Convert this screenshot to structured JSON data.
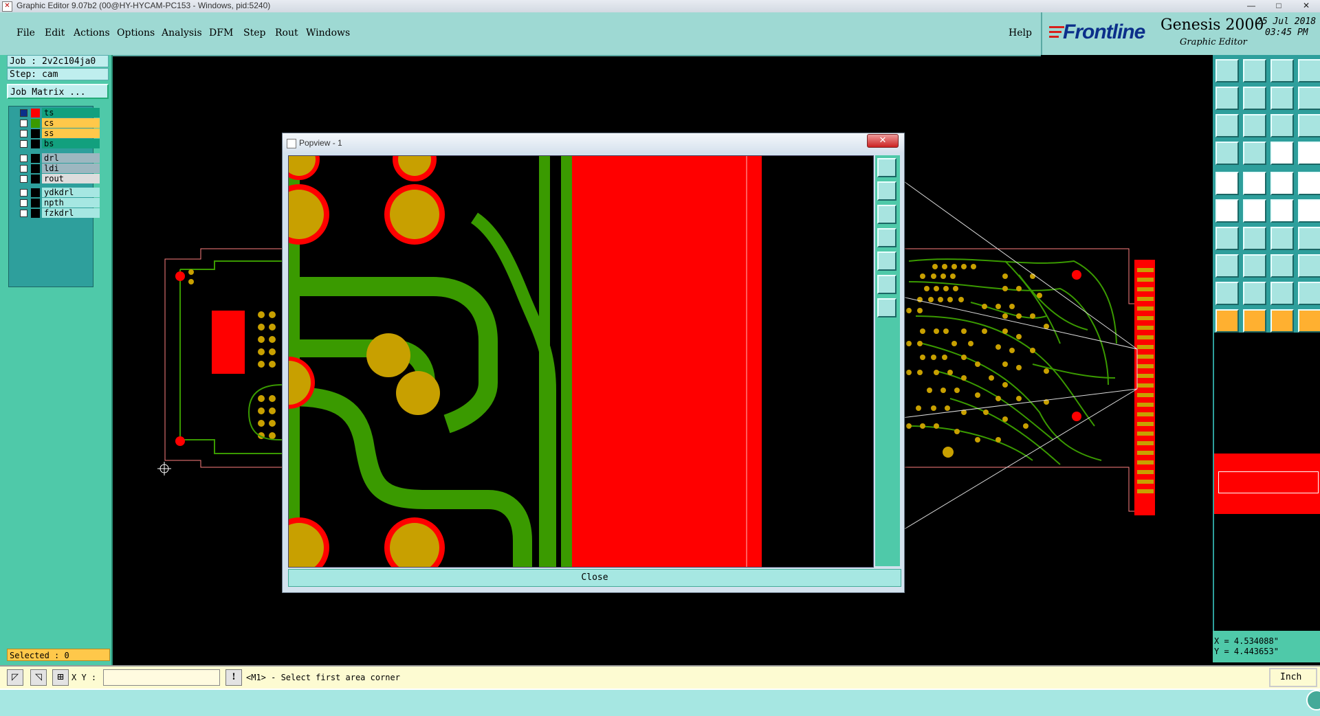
{
  "window": {
    "title": "Graphic Editor 9.07b2 (00@HY-HYCAM-PC153 - Windows, pid:5240)",
    "minimize": "—",
    "maximize": "□",
    "close": "✕"
  },
  "menu": {
    "items": [
      "File",
      "Edit",
      "Actions",
      "Options",
      "Analysis",
      "DFM",
      "Step",
      "Rout",
      "Windows"
    ],
    "help": "Help"
  },
  "brand": {
    "logo": "Frontline",
    "product": "Genesis 2000",
    "subtitle": "Graphic Editor",
    "date": "25 Jul 2018",
    "time": "03:45 PM",
    "accent": "#d8201a"
  },
  "left_panel": {
    "job": "Job : 2v2c104ja0",
    "step": "Step: cam",
    "job_matrix": "Job Matrix ...",
    "layers": [
      {
        "name": "ts",
        "swatch": "#ff0000",
        "bg": "#12a07e",
        "active": true
      },
      {
        "name": "cs",
        "swatch": "#3a9a00",
        "bg": "#ffc84a",
        "active": false
      },
      {
        "name": "ss",
        "swatch": "#000000",
        "bg": "#ffc84a",
        "active": false
      },
      {
        "name": "bs",
        "swatch": "#000000",
        "bg": "#12a07e",
        "active": false
      },
      {
        "name": "drl",
        "swatch": "#000000",
        "bg": "#9db7c0",
        "active": false
      },
      {
        "name": "ldi",
        "swatch": "#000000",
        "bg": "#9db7c0",
        "active": false
      },
      {
        "name": "rout",
        "swatch": "#000000",
        "bg": "#dddddd",
        "active": false
      },
      {
        "name": "ydkdrl",
        "swatch": "#000000",
        "bg": "#a6e7e2",
        "active": false
      },
      {
        "name": "npth",
        "swatch": "#000000",
        "bg": "#a6e7e2",
        "active": false
      },
      {
        "name": "fzkdrl",
        "swatch": "#000000",
        "bg": "#a6e7e2",
        "active": false
      }
    ],
    "selected": "Selected : 0"
  },
  "popview": {
    "title": "Popview - 1",
    "close_label": "Close",
    "close_x": "✕"
  },
  "command_bar": {
    "xy_label": "X Y :",
    "xy_value": "",
    "message": "<M1> - Select first area corner",
    "units": "Inch"
  },
  "coords": {
    "x": "X = 4.534088\"",
    "y": "Y = 4.443653\""
  },
  "colors": {
    "copper_trace": "#3a9a00",
    "pad_gold": "#c8a000",
    "top_red": "#ff0000",
    "panel_teal": "#4fc9a9",
    "menu_teal": "#9ed9d3"
  }
}
